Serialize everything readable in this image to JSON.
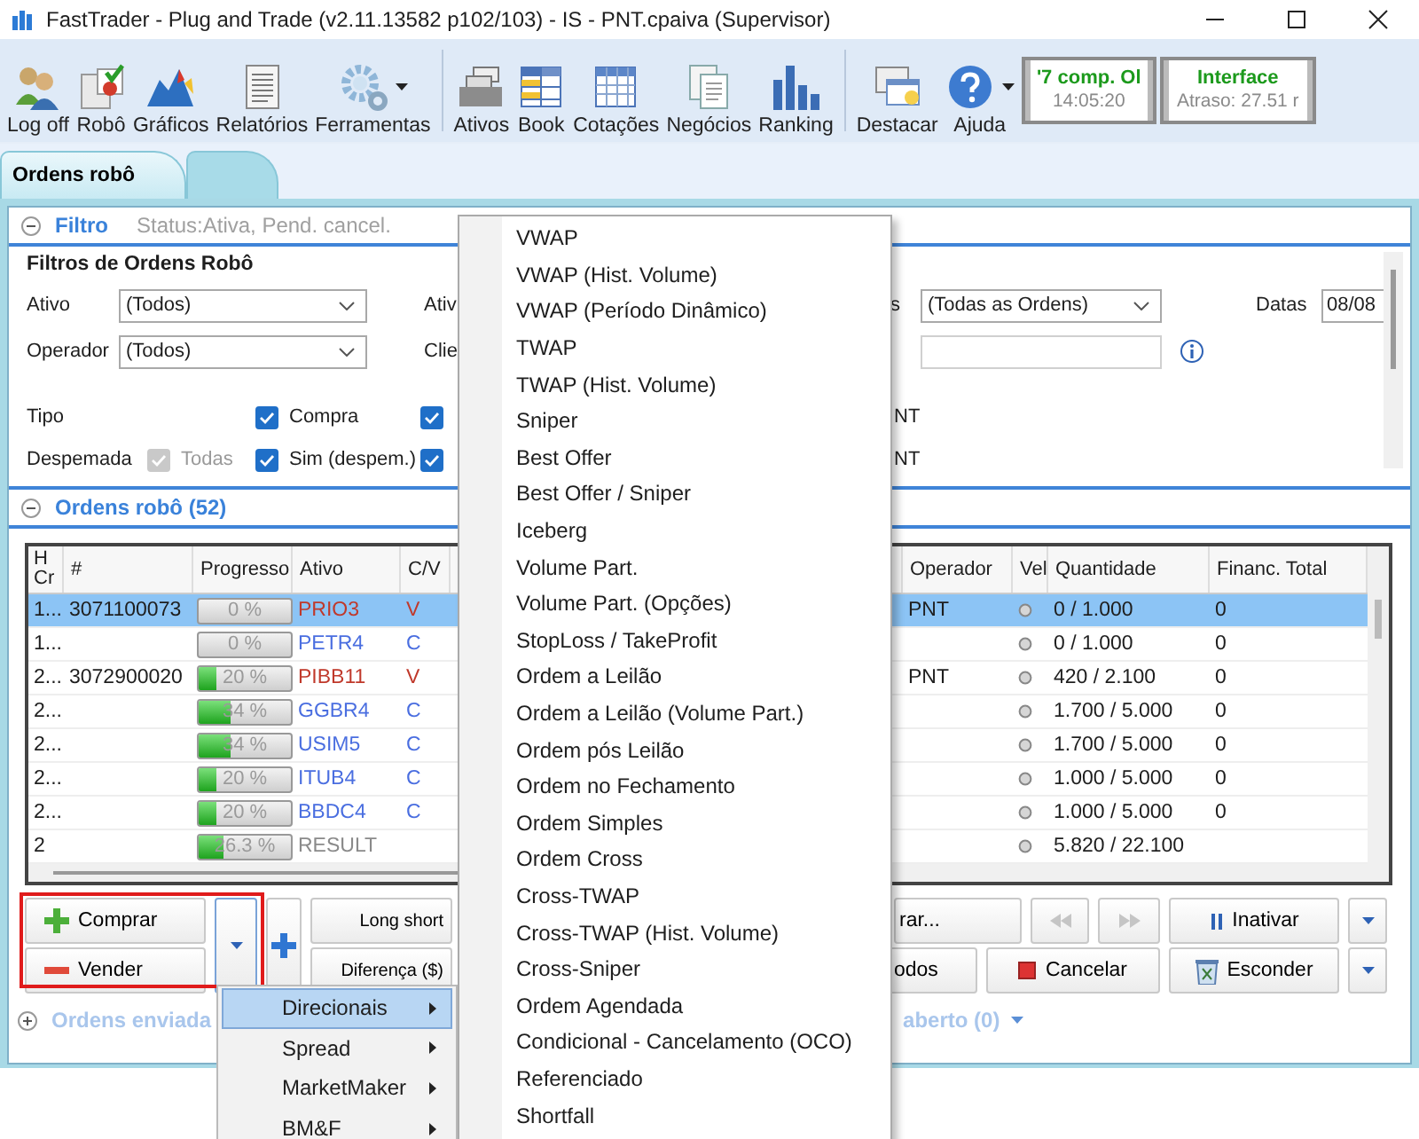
{
  "window": {
    "title": "FastTrader - Plug and Trade (v2.11.13582 p102/103) - IS - PNT.cpaiva (Supervisor)"
  },
  "toolbar": {
    "groups": [
      [
        {
          "label": "Log off"
        },
        {
          "label": "Robô"
        },
        {
          "label": "Gráficos"
        },
        {
          "label": "Relatórios"
        },
        {
          "label": "Ferramentas",
          "dropdown": true
        }
      ],
      [
        {
          "label": "Ativos"
        },
        {
          "label": "Book"
        },
        {
          "label": "Cotações"
        },
        {
          "label": "Negócios"
        },
        {
          "label": "Ranking"
        }
      ],
      [
        {
          "label": "Destacar"
        },
        {
          "label": "Ajuda",
          "dropdown": true
        }
      ]
    ],
    "status_panels": [
      {
        "line_1": "'7 comp. Ol",
        "line_2": "14:05:20"
      },
      {
        "line_1": "Interface",
        "line_2": "Atraso: 27.51 r"
      }
    ]
  },
  "tabs": [
    {
      "label": "Ordens robô",
      "selected": true
    },
    {
      "selected": false
    }
  ],
  "filter_section": {
    "title": "Filtro",
    "summary": "Status:Ativa, Pend. cancel.",
    "expanded": true
  },
  "filters": {
    "title": "Filtros de Ordens Robô",
    "fields": [
      {
        "label": "Ativo",
        "value": "(Todos)",
        "column_2_label": "Ativ"
      },
      {
        "label": "Operador",
        "value": "(Todos)",
        "column_2_label": "Clie"
      }
    ],
    "orders_filter": {
      "label": "s",
      "value": "(Todas as Ordens)"
    },
    "dates": {
      "label": "Datas",
      "value": "08/08"
    },
    "check_rows": [
      {
        "label": "Tipo",
        "options": [
          {
            "label": "Compra",
            "checked": true
          },
          {
            "checked": true
          }
        ],
        "trailing": "NT"
      },
      {
        "label": "Despemada",
        "options": [
          {
            "label": "Todas",
            "checked": true,
            "disabled": true
          },
          {
            "label": "Sim (despem.)",
            "checked": true
          },
          {
            "checked": true
          }
        ],
        "trailing": "NT"
      }
    ]
  },
  "orders_section": {
    "title": "Ordens robô (52)",
    "expanded": true
  },
  "table": {
    "columns": [
      "H Cr",
      "#",
      "Progresso",
      "Ativo",
      "C/V",
      "Operador",
      "Vel",
      "Quantidade",
      "Financ. Total"
    ],
    "rows": [
      {
        "h": "1...",
        "id": "3071100073",
        "progress": "0 %",
        "level": 0,
        "ticker": "PRIO3",
        "side": "V",
        "color": "#c0392b",
        "operator": "PNT",
        "quantity": "0 / 1.000",
        "total": "0",
        "selected": true
      },
      {
        "h": "1...",
        "progress": "0 %",
        "level": 0,
        "ticker": "PETR4",
        "side": "C",
        "color": "#4a6ee0",
        "quantity": "0 / 1.000",
        "total": "0",
        "selected": false
      },
      {
        "h": "2...",
        "id": "3072900020",
        "progress": "20 %",
        "level": 0.2,
        "ticker": "PIBB11",
        "side": "V",
        "color": "#c0392b",
        "operator": "PNT",
        "quantity": "420 / 2.100",
        "total": "0",
        "selected": false
      },
      {
        "h": "2...",
        "progress": "34 %",
        "level": 0.34,
        "ticker": "GGBR4",
        "side": "C",
        "color": "#4a6ee0",
        "quantity": "1.700 / 5.000",
        "total": "0",
        "selected": false
      },
      {
        "h": "2...",
        "progress": "34 %",
        "level": 0.34,
        "ticker": "USIM5",
        "side": "C",
        "color": "#4a6ee0",
        "quantity": "1.700 / 5.000",
        "total": "0",
        "selected": false
      },
      {
        "h": "2...",
        "progress": "20 %",
        "level": 0.2,
        "ticker": "ITUB4",
        "side": "C",
        "color": "#4a6ee0",
        "quantity": "1.000 / 5.000",
        "total": "0",
        "selected": false
      },
      {
        "h": "2...",
        "progress": "20 %",
        "level": 0.2,
        "ticker": "BBDC4",
        "side": "C",
        "color": "#4a6ee0",
        "quantity": "1.000 / 5.000",
        "total": "0",
        "selected": false
      },
      {
        "h": "2",
        "progress": "26.3 %",
        "level": 0.263,
        "ticker": "RESULT",
        "color": "#8a8a8a",
        "quantity": "5.820 / 22.100",
        "selected": false
      }
    ]
  },
  "actions": {
    "buy": "Comprar",
    "sell": "Vender",
    "strategy_1": "Long short",
    "strategy_2": "Diferença ($)",
    "button_3": "rar...",
    "navigation_disabled": true,
    "inactivate": "Inativar",
    "button_4": "odos",
    "cancel": "Cancelar",
    "hide": "Esconder"
  },
  "footer": {
    "sent_orders": {
      "title": "Ordens enviada",
      "expanded": false
    },
    "text_2": "aberto (0)"
  },
  "context_menu": {
    "items": [
      {
        "label": "Direcionais",
        "selected": true
      },
      {
        "label": "Spread",
        "selected": false
      },
      {
        "label": "MarketMaker",
        "selected": false
      },
      {
        "label": "BM&F",
        "selected": false
      }
    ]
  },
  "submenu": {
    "items": [
      "VWAP",
      "VWAP (Hist. Volume)",
      "VWAP (Período Dinâmico)",
      "TWAP",
      "TWAP (Hist. Volume)",
      "Sniper",
      "Best Offer",
      "Best Offer / Sniper",
      "Iceberg",
      "Volume Part.",
      "Volume Part. (Opções)",
      "StopLoss / TakeProfit",
      "Ordem a Leilão",
      "Ordem a Leilão (Volume Part.)",
      "Ordem pós Leilão",
      "Ordem no Fechamento",
      "Ordem Simples",
      "Ordem Cross",
      "Cross-TWAP",
      "Cross-TWAP (Hist. Volume)",
      "Cross-Sniper",
      "Ordem Agendada",
      "Condicional - Cancelamento (OCO)",
      "Referenciado",
      "Shortfall"
    ]
  }
}
